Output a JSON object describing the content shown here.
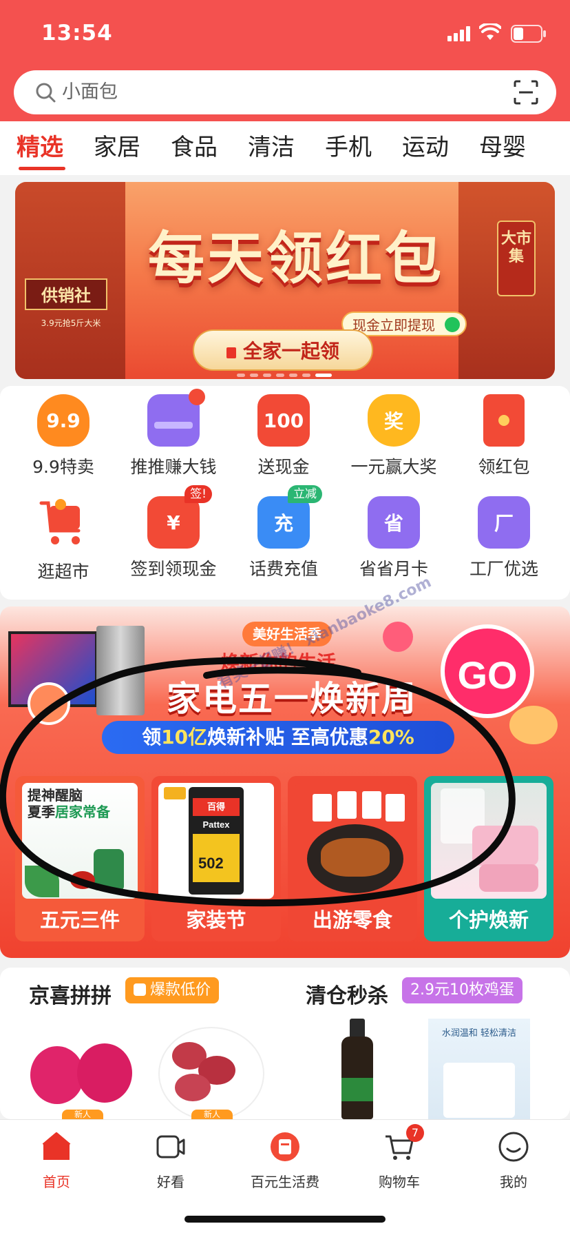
{
  "status_bar": {
    "time": "13:54"
  },
  "search": {
    "placeholder": "小面包"
  },
  "tabs": [
    "精选",
    "家居",
    "食品",
    "清洁",
    "手机",
    "运动",
    "母婴"
  ],
  "banner": {
    "title": "每天领红包",
    "cash_tag": "现金立即提现",
    "button": "全家一起领",
    "left_sign": "供销社",
    "left_note": "3.9元抢5斤大米",
    "right_sign": "大市集",
    "colors": {
      "main": "#ea4a31",
      "text": "#fff1c9"
    }
  },
  "grid": [
    {
      "label": "9.9特卖",
      "icon": "flame-99-icon",
      "glyph": "9.9",
      "color": "#ff8a1f"
    },
    {
      "label": "推推赚大钱",
      "icon": "wallet-icon",
      "glyph": "",
      "color": "#8f6df0"
    },
    {
      "label": "送现金",
      "icon": "cash-100-icon",
      "glyph": "100",
      "color": "#f24a36"
    },
    {
      "label": "一元赢大奖",
      "icon": "gold-ingot-icon",
      "glyph": "奖",
      "color": "#ffb81f"
    },
    {
      "label": "领红包",
      "icon": "red-envelope-icon",
      "glyph": "",
      "color": "#f24a36"
    },
    {
      "label": "逛超市",
      "icon": "shopping-cart-icon",
      "glyph": "",
      "color": "#f24a36"
    },
    {
      "label": "签到领现金",
      "icon": "calendar-yen-icon",
      "glyph": "¥",
      "color": "#f24a36",
      "badge": "签!"
    },
    {
      "label": "话费充值",
      "icon": "phone-charge-icon",
      "glyph": "充",
      "color": "#3a8cf5",
      "badge": "立减"
    },
    {
      "label": "省省月卡",
      "icon": "save-card-icon",
      "glyph": "省",
      "color": "#8f6df0"
    },
    {
      "label": "工厂优选",
      "icon": "factory-icon",
      "glyph": "厂",
      "color": "#8f6df0"
    }
  ],
  "promo": {
    "season_tag": "美好生活季",
    "sub_title": "焕新你的生活",
    "main_title": "家电五一焕新周",
    "strip_prefix": "领",
    "strip_highlight1": "10亿",
    "strip_middle": "焕新补贴 至高优惠",
    "strip_highlight2": "20%",
    "go": "GO",
    "cards": [
      {
        "label": "五元三件",
        "line1": "提神醒脑",
        "line2a": "夏季",
        "line2b": "居家常备"
      },
      {
        "label": "家装节",
        "brand": "百得 Pattex",
        "model": "502"
      },
      {
        "label": "出游零食"
      },
      {
        "label": "个护焕新"
      }
    ]
  },
  "watermark": "有奖一起赚！ xianbaoke8.com",
  "deals": {
    "left_title": "京喜拼拼",
    "left_tag": "爆款低价",
    "right_title": "清仓秒杀",
    "right_tag": "2.9元10枚鸡蛋",
    "tissue_text": "水润温和 轻松清洁",
    "new_badge": "新人"
  },
  "tabbar": [
    {
      "label": "首页",
      "icon": "home-icon",
      "active": true
    },
    {
      "label": "好看",
      "icon": "video-icon"
    },
    {
      "label": "百元生活费",
      "icon": "red-packet-icon"
    },
    {
      "label": "购物车",
      "icon": "cart-icon",
      "badge": "7"
    },
    {
      "label": "我的",
      "icon": "profile-icon"
    }
  ]
}
